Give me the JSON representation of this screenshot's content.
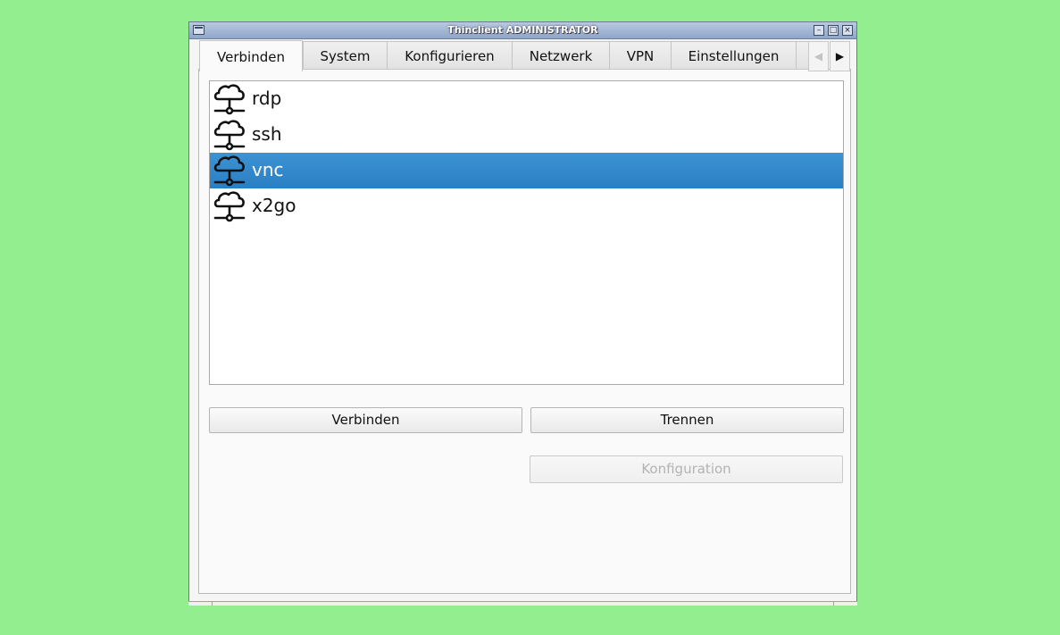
{
  "window": {
    "title": "Thinclient ADMINISTRATOR",
    "controls": [
      "minimize",
      "maximize",
      "close"
    ]
  },
  "tabs": [
    {
      "label": "Verbinden",
      "active": true
    },
    {
      "label": "System",
      "active": false
    },
    {
      "label": "Konfigurieren",
      "active": false
    },
    {
      "label": "Netzwerk",
      "active": false
    },
    {
      "label": "VPN",
      "active": false
    },
    {
      "label": "Einstellungen",
      "active": false
    }
  ],
  "connections": [
    {
      "label": "rdp",
      "icon": "cloud-network-icon",
      "selected": false
    },
    {
      "label": "ssh",
      "icon": "cloud-network-icon",
      "selected": false
    },
    {
      "label": "vnc",
      "icon": "cloud-network-icon",
      "selected": true
    },
    {
      "label": "x2go",
      "icon": "cloud-network-icon",
      "selected": false
    }
  ],
  "buttons": {
    "connect_label": "Verbinden",
    "disconnect_label": "Trennen",
    "config_label": "Konfiguration"
  },
  "colors": {
    "desktop": "#93ee8f",
    "selection": "#2f88cb"
  }
}
